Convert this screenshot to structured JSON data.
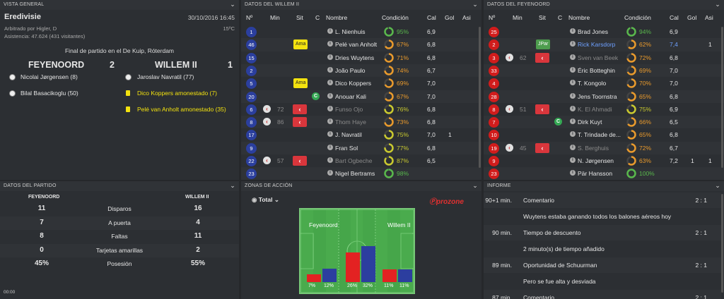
{
  "overview": {
    "header": "VISTA GENERAL",
    "competition": "Eredivisie",
    "datetime": "30/10/2016 16:45",
    "referee": "Arbitrado por Higler, D",
    "temperature": "15ºC",
    "attendance": "Asistencia: 47.624 (431 visitantes)",
    "result_text": "Final de partido en el De Kuip, Róterdam",
    "home_team": "FEYENOORD",
    "home_score": "2",
    "away_team": "WILLEM II",
    "away_score": "1",
    "events": [
      {
        "side": "home",
        "icon": "ball-icon",
        "text": "Nicolai Jørgensen (8)"
      },
      {
        "side": "home",
        "icon": "ball-icon",
        "text": "Bilal Basacikoglu (50)"
      },
      {
        "side": "away",
        "icon": "ball-icon",
        "text": "Jaroslav Navratil (77)"
      },
      {
        "side": "away",
        "icon": "yellow-card-icon",
        "text": "Dico Koppers amonestado (7)"
      },
      {
        "side": "away",
        "icon": "yellow-card-icon",
        "text": "Pelé van Anholt amonestado (35)"
      }
    ],
    "clock": "00:00"
  },
  "willem": {
    "header": "DATOS DEL WILLEM II",
    "columns": {
      "num": "Nº",
      "min": "Min",
      "sit": "Sit",
      "c": "C",
      "name": "Nombre",
      "cond": "Condición",
      "cal": "Cal",
      "gol": "Gol",
      "asi": "Asi"
    },
    "rows": [
      {
        "num": "1",
        "min": "",
        "sit": "",
        "cap": false,
        "name": "L. Nienhuis",
        "cond": "95%",
        "cond_val": 95,
        "cal": "6,9",
        "gol": "",
        "asi": "",
        "subbed": false
      },
      {
        "num": "46",
        "min": "",
        "sit": "Ama",
        "cap": false,
        "name": "Pelé van Anholt",
        "cond": "67%",
        "cond_val": 67,
        "cal": "6,8",
        "gol": "",
        "asi": "",
        "subbed": false
      },
      {
        "num": "15",
        "min": "",
        "sit": "",
        "cap": false,
        "name": "Dries Wuytens",
        "cond": "71%",
        "cond_val": 71,
        "cal": "6,8",
        "gol": "",
        "asi": "",
        "subbed": false
      },
      {
        "num": "2",
        "min": "",
        "sit": "",
        "cap": false,
        "name": "João Paulo",
        "cond": "74%",
        "cond_val": 74,
        "cal": "6,7",
        "gol": "",
        "asi": "",
        "subbed": false
      },
      {
        "num": "5",
        "min": "",
        "sit": "Ama",
        "cap": false,
        "name": "Dico Koppers",
        "cond": "69%",
        "cond_val": 69,
        "cal": "7,0",
        "gol": "",
        "asi": "",
        "subbed": false
      },
      {
        "num": "20",
        "min": "",
        "sit": "",
        "cap": true,
        "name": "Anouar Kali",
        "cond": "67%",
        "cond_val": 67,
        "cal": "7,0",
        "gol": "",
        "asi": "",
        "subbed": false
      },
      {
        "num": "6",
        "min": "72",
        "sit": "",
        "cap": false,
        "name": "Funso Ojo",
        "cond": "76%",
        "cond_val": 76,
        "cal": "6,8",
        "gol": "",
        "asi": "",
        "subbed": true
      },
      {
        "num": "8",
        "min": "86",
        "sit": "",
        "cap": false,
        "name": "Thom Haye",
        "cond": "73%",
        "cond_val": 73,
        "cal": "6,8",
        "gol": "",
        "asi": "",
        "subbed": true
      },
      {
        "num": "17",
        "min": "",
        "sit": "",
        "cap": false,
        "name": "J. Navratil",
        "cond": "75%",
        "cond_val": 75,
        "cal": "7,0",
        "gol": "1",
        "asi": "",
        "subbed": false
      },
      {
        "num": "9",
        "min": "",
        "sit": "",
        "cap": false,
        "name": "Fran Sol",
        "cond": "77%",
        "cond_val": 77,
        "cal": "6,8",
        "gol": "",
        "asi": "",
        "subbed": false
      },
      {
        "num": "22",
        "min": "57",
        "sit": "",
        "cap": false,
        "name": "Bart Ogbeche",
        "cond": "87%",
        "cond_val": 87,
        "cal": "6,5",
        "gol": "",
        "asi": "",
        "subbed": true
      },
      {
        "num": "23",
        "min": "",
        "sit": "",
        "cap": false,
        "name": "Nigel Bertrams",
        "cond": "98%",
        "cond_val": 98,
        "cal": "",
        "gol": "",
        "asi": "",
        "subbed": false
      }
    ]
  },
  "feyenoord": {
    "header": "DATOS DEL FEYENOORD",
    "columns": {
      "num": "Nº",
      "min": "Min",
      "sit": "Sit",
      "c": "C",
      "name": "Nombre",
      "cond": "Condición",
      "cal": "Cal",
      "gol": "Gol",
      "asi": "Asi"
    },
    "rows": [
      {
        "num": "25",
        "min": "",
        "sit": "",
        "cap": false,
        "name": "Brad Jones",
        "cond": "94%",
        "cond_val": 94,
        "cal": "6,9",
        "gol": "",
        "asi": "",
        "subbed": false,
        "highlight": false
      },
      {
        "num": "2",
        "min": "",
        "sit": "JPar",
        "cap": false,
        "name": "Rick Karsdorp",
        "cond": "62%",
        "cond_val": 62,
        "cal": "7,4",
        "gol": "",
        "asi": "1",
        "subbed": false,
        "highlight": true
      },
      {
        "num": "3",
        "min": "62",
        "sit": "",
        "cap": false,
        "name": "Sven van Beek",
        "cond": "72%",
        "cond_val": 72,
        "cal": "6,8",
        "gol": "",
        "asi": "",
        "subbed": true,
        "highlight": false
      },
      {
        "num": "33",
        "min": "",
        "sit": "",
        "cap": false,
        "name": "Éric Botteghin",
        "cond": "69%",
        "cond_val": 69,
        "cal": "7,0",
        "gol": "",
        "asi": "",
        "subbed": false,
        "highlight": false
      },
      {
        "num": "4",
        "min": "",
        "sit": "",
        "cap": false,
        "name": "T. Kongolo",
        "cond": "70%",
        "cond_val": 70,
        "cal": "7,0",
        "gol": "",
        "asi": "",
        "subbed": false,
        "highlight": false
      },
      {
        "num": "28",
        "min": "",
        "sit": "",
        "cap": false,
        "name": "Jens Toornstra",
        "cond": "65%",
        "cond_val": 65,
        "cal": "6,8",
        "gol": "",
        "asi": "",
        "subbed": false,
        "highlight": false
      },
      {
        "num": "8",
        "min": "51",
        "sit": "",
        "cap": false,
        "name": "K. El Ahmadi",
        "cond": "75%",
        "cond_val": 75,
        "cal": "6,9",
        "gol": "",
        "asi": "",
        "subbed": true,
        "highlight": false
      },
      {
        "num": "7",
        "min": "",
        "sit": "",
        "cap": true,
        "name": "Dirk Kuyt",
        "cond": "66%",
        "cond_val": 66,
        "cal": "6,5",
        "gol": "",
        "asi": "",
        "subbed": false,
        "highlight": false
      },
      {
        "num": "10",
        "min": "",
        "sit": "",
        "cap": false,
        "name": "T. Trindade de...",
        "cond": "65%",
        "cond_val": 65,
        "cal": "6,8",
        "gol": "",
        "asi": "",
        "subbed": false,
        "highlight": false
      },
      {
        "num": "19",
        "min": "45",
        "sit": "",
        "cap": false,
        "name": "S. Berghuis",
        "cond": "72%",
        "cond_val": 72,
        "cal": "6,7",
        "gol": "",
        "asi": "",
        "subbed": true,
        "highlight": false
      },
      {
        "num": "9",
        "min": "",
        "sit": "",
        "cap": false,
        "name": "N. Jørgensen",
        "cond": "63%",
        "cond_val": 63,
        "cal": "7,2",
        "gol": "1",
        "asi": "1",
        "subbed": false,
        "highlight": false
      },
      {
        "num": "23",
        "min": "",
        "sit": "",
        "cap": false,
        "name": "Pär Hansson",
        "cond": "100%",
        "cond_val": 100,
        "cal": "",
        "gol": "",
        "asi": "",
        "subbed": false,
        "highlight": false
      }
    ]
  },
  "match_stats": {
    "header": "DATOS DEL PARTIDO",
    "home_team": "FEYENOORD",
    "away_team": "WILLEM II",
    "rows": [
      {
        "home": "11",
        "label": "Disparos",
        "away": "16"
      },
      {
        "home": "7",
        "label": "A puerta",
        "away": "4"
      },
      {
        "home": "8",
        "label": "Faltas",
        "away": "11"
      },
      {
        "home": "0",
        "label": "Tarjetas amarillas",
        "away": "2"
      },
      {
        "home": "45%",
        "label": "Posesión",
        "away": "55%"
      }
    ]
  },
  "action_zones": {
    "header": "ZONAS DE ACCIÓN",
    "filter": "Total",
    "brand": "prozone",
    "home_label": "Feyenoord",
    "away_label": "Willem II",
    "zones": [
      {
        "home": "7%",
        "home_val": 7,
        "away": "12%",
        "away_val": 12
      },
      {
        "home": "26%",
        "home_val": 26,
        "away": "32%",
        "away_val": 32
      },
      {
        "home": "11%",
        "home_val": 11,
        "away": "11%",
        "away_val": 11
      }
    ],
    "colors": {
      "home": "#e32222",
      "away": "#2c3e9f"
    }
  },
  "report": {
    "header": "INFORME",
    "entries": [
      {
        "minute": "90+1 min.",
        "title": "Comentario",
        "score": "2 : 1",
        "text": "Wuytens estaba ganando todos los balones aéreos hoy"
      },
      {
        "minute": "90 min.",
        "title": "Tiempo de descuento",
        "score": "2 : 1",
        "text": "2 minuto(s) de tiempo añadido"
      },
      {
        "minute": "89 min.",
        "title": "Oportunidad de Schuurman",
        "score": "2 : 1",
        "text": "Pero se fue alta y desviada"
      },
      {
        "minute": "87 min.",
        "title": "Comentario",
        "score": "2 : 1",
        "text": ""
      }
    ]
  }
}
